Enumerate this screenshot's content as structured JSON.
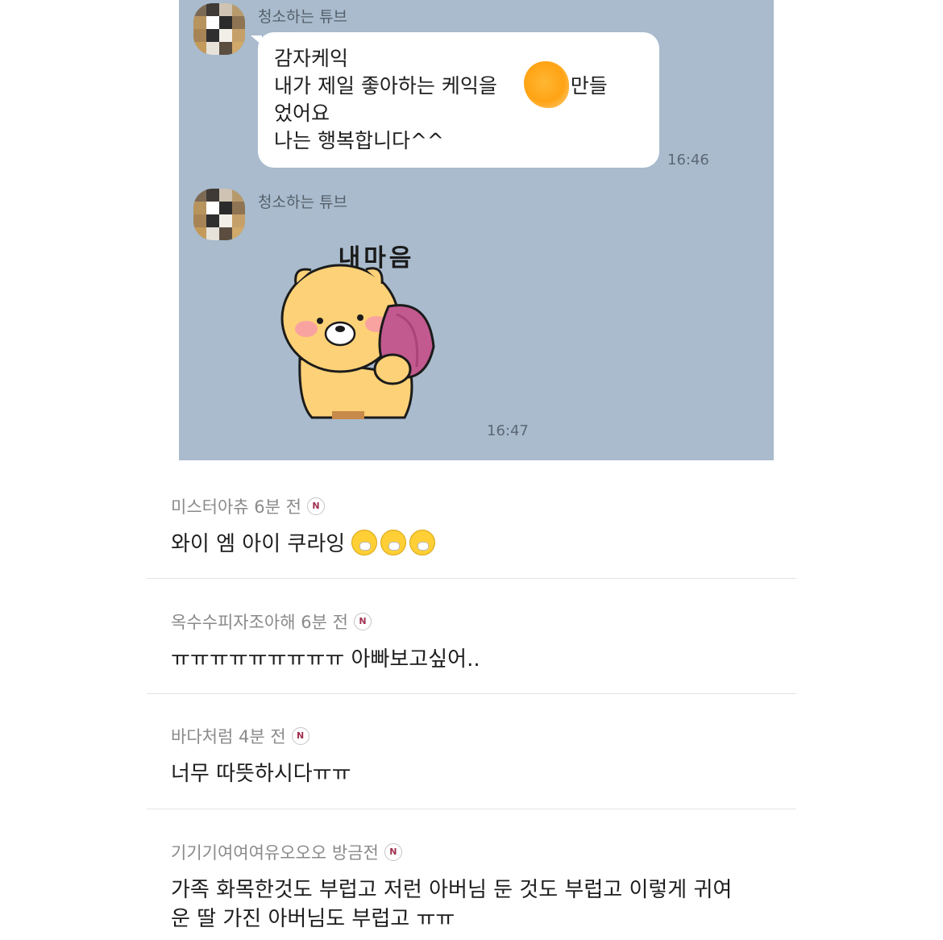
{
  "chat": {
    "messages": [
      {
        "sender": "청소하는 튜브",
        "lines": [
          "감자케익",
          "내가  제일  좋아하는 케익을",
          "가  만들",
          "었어요",
          "나는  행복합니다^^"
        ],
        "time": "16:46"
      },
      {
        "sender": "청소하는 튜브",
        "sticker_text": "내마음",
        "time": "16:47"
      }
    ]
  },
  "comments": [
    {
      "author": "미스터아츄",
      "ago": "6분 전",
      "badge": "N",
      "text": "와이 엠 아이 쿠라잉",
      "emoji_count": 3
    },
    {
      "author": "옥수수피자조아해",
      "ago": "6분 전",
      "badge": "N",
      "text": "ㅠㅠㅠㅠㅠㅠㅠㅠㅠ 아빠보고싶어.."
    },
    {
      "author": "바다처럼",
      "ago": "4분 전",
      "badge": "N",
      "text": "너무 따뜻하시다ㅠㅠ"
    },
    {
      "author": "기기기여여여유오오오",
      "ago": "방금전",
      "badge": "N",
      "text_lines": [
        "가족 화목한것도 부럽고 저런 아버님 둔 것도 부럽고 이렇게 귀여",
        "운 딸 가진 아버님도 부럽고 ㅠㅠ"
      ]
    }
  ],
  "colors": {
    "chat_bg": "#a9bbcd",
    "bubble": "#ffffff",
    "badge_n": "#a03050"
  }
}
